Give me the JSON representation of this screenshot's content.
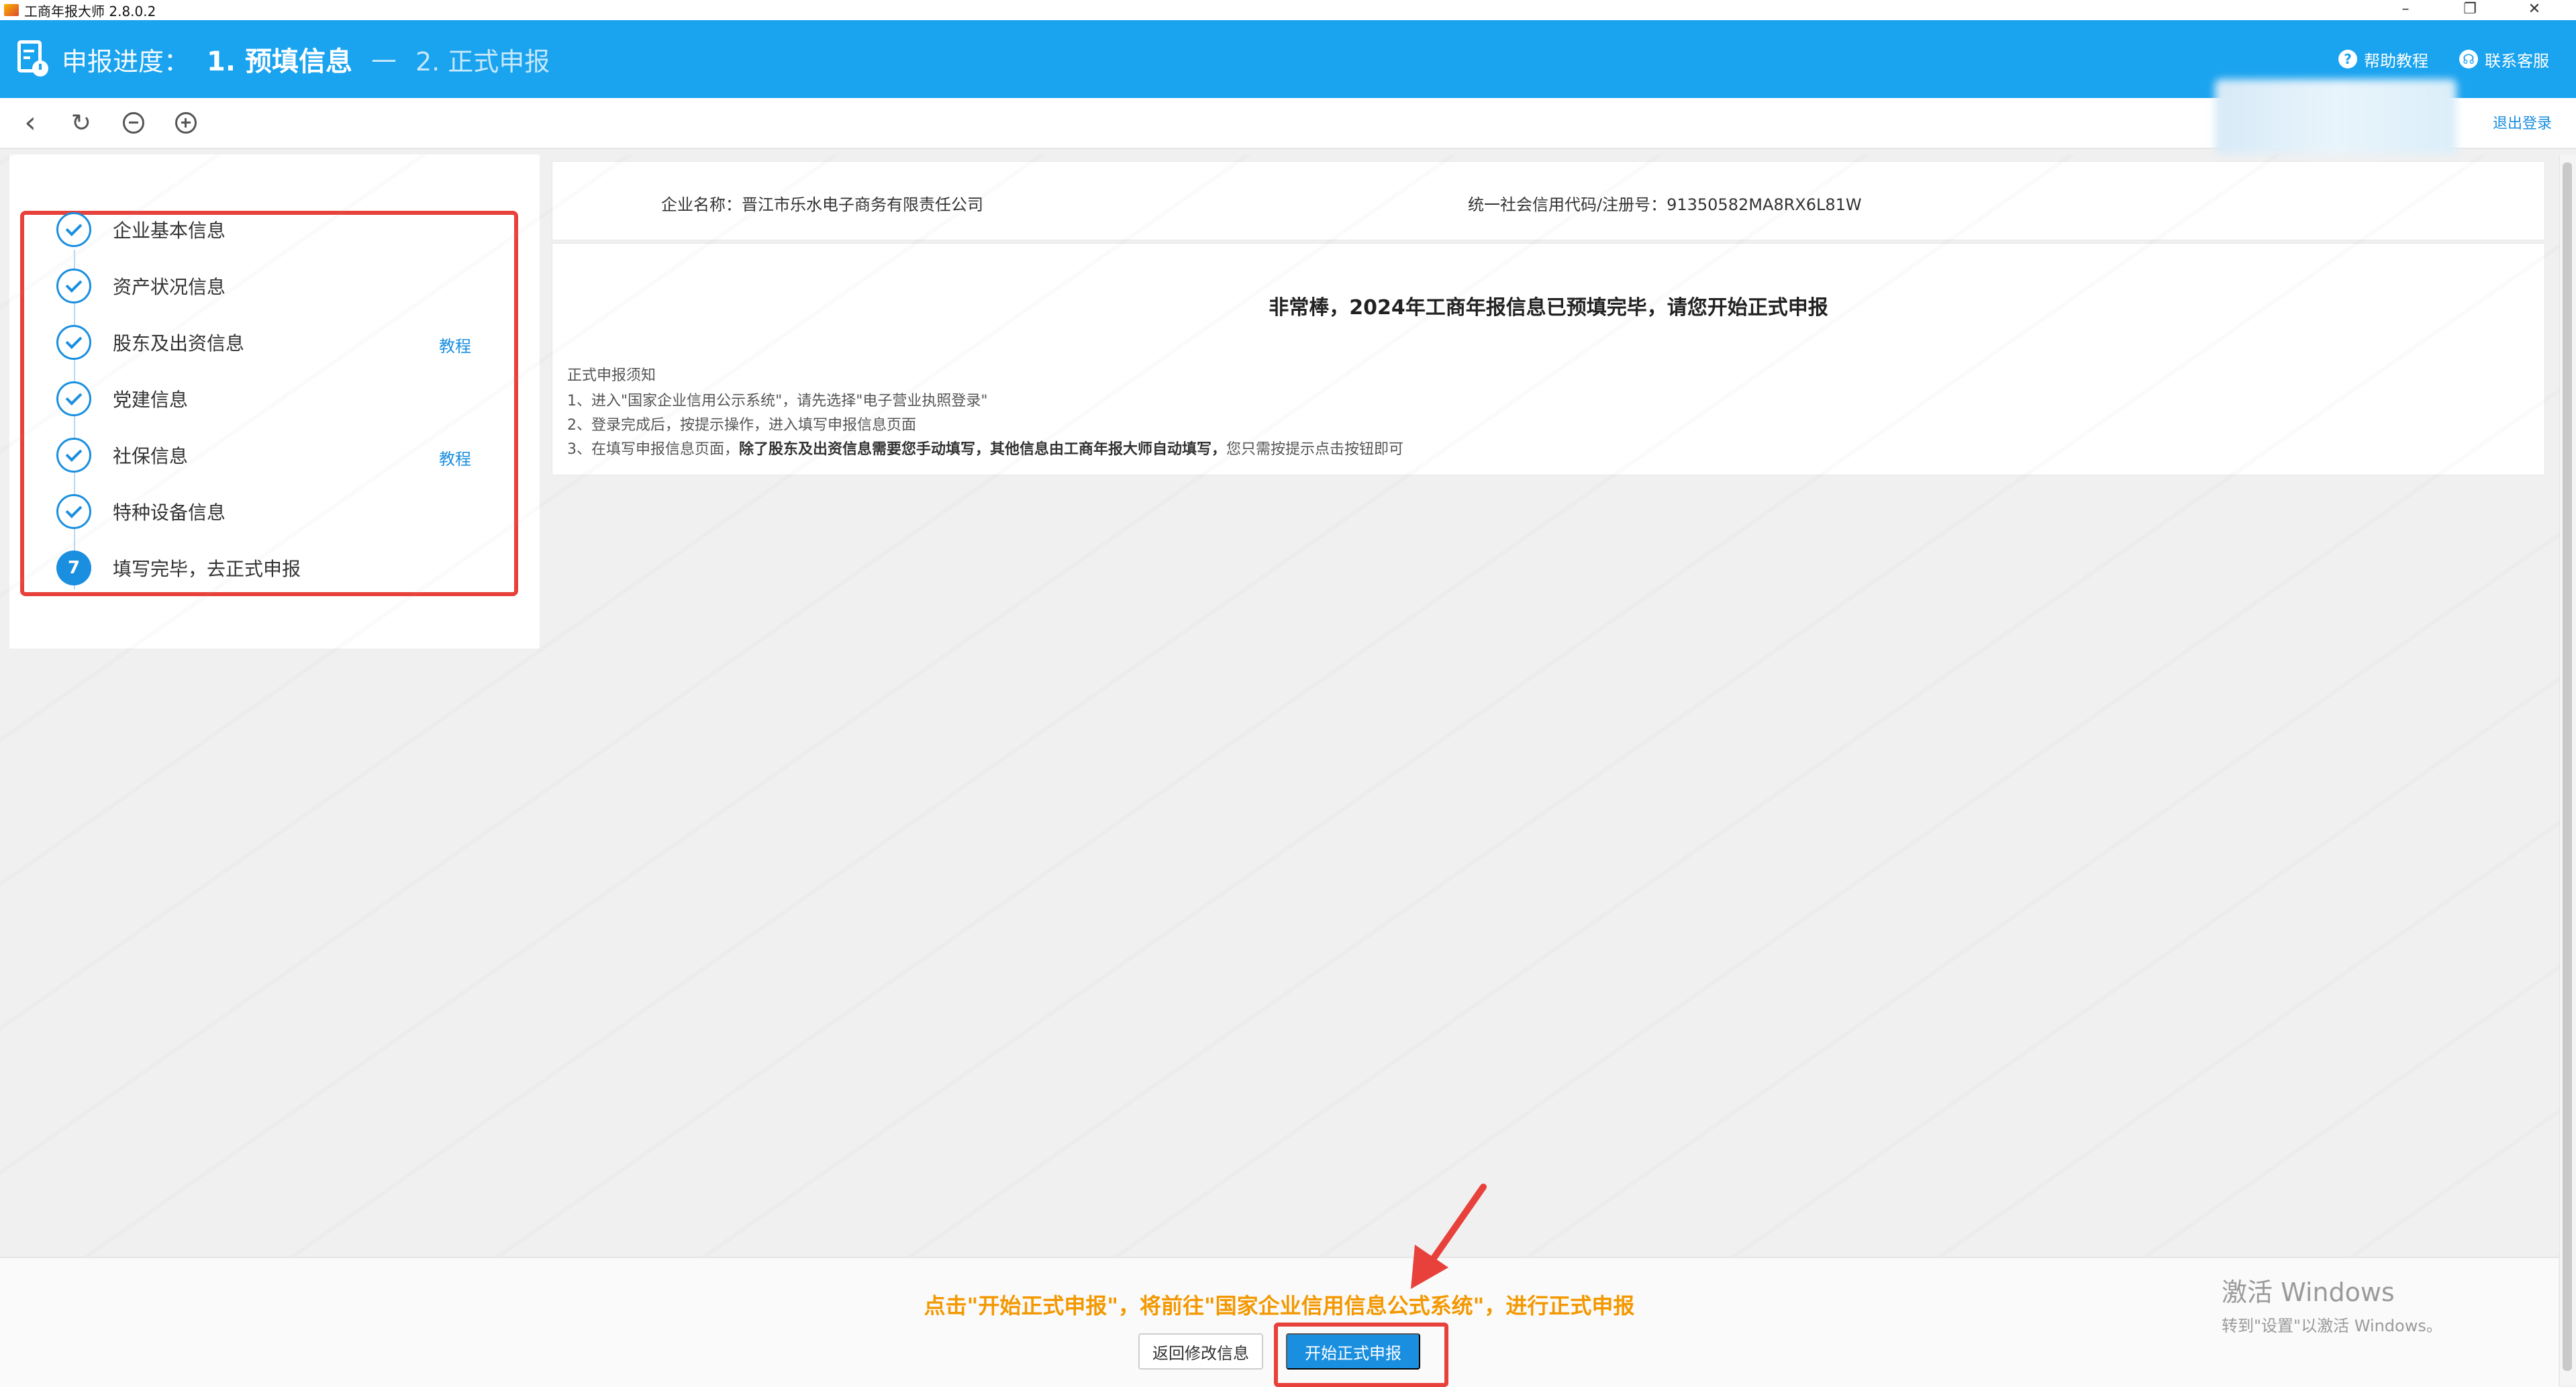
{
  "window": {
    "title": "工商年报大师 2.8.0.2",
    "controls": [
      "–",
      "❐",
      "✕"
    ]
  },
  "header": {
    "progress_label": "申报进度：",
    "step1": "1. 预填信息",
    "separator": "—",
    "step2": "2. 正式申报",
    "help_label": "帮助教程",
    "contact_label": "联系客服",
    "background_color": "#1aa3ef"
  },
  "toolbar": {
    "back_icon": "chevron-left-icon",
    "refresh_icon": "refresh-icon",
    "zoom_out_icon": "zoom-out-icon",
    "zoom_in_icon": "zoom-in-icon",
    "logout_label": "退出登录"
  },
  "sidebar": {
    "steps": [
      {
        "label": "企业基本信息",
        "status": "done",
        "link": ""
      },
      {
        "label": "资产状况信息",
        "status": "done",
        "link": ""
      },
      {
        "label": "股东及出资信息",
        "status": "done",
        "link": "教程"
      },
      {
        "label": "党建信息",
        "status": "done",
        "link": ""
      },
      {
        "label": "社保信息",
        "status": "done",
        "link": "教程"
      },
      {
        "label": "特种设备信息",
        "status": "done",
        "link": ""
      },
      {
        "label": "填写完毕，去正式申报",
        "status": "current",
        "number": "7",
        "link": ""
      }
    ]
  },
  "company": {
    "name": "企业名称：晋江市乐水电子商务有限责任公司",
    "credit_code": "统一社会信用代码/注册号：91350582MA8RX6L81W"
  },
  "notice": {
    "headline": "非常棒，2024年工商年报信息已预填完毕，请您开始正式申报",
    "title": "正式申报须知",
    "line1": "1、进入\"国家企业信用公示系统\"，请先选择\"电子营业执照登录\"",
    "line2": "2、登录完成后，按提示操作，进入填写申报信息页面",
    "line3_prefix": "3、在填写申报信息页面，",
    "line3_bold": "除了股东及出资信息需要您手动填写，其他信息由工商年报大师自动填写，",
    "line3_suffix": "您只需按提示点击按钮即可"
  },
  "bottom": {
    "note": "点击\"开始正式申报\"，将前往\"国家企业信用信息公式系统\"，进行正式申报",
    "back_button": "返回修改信息",
    "start_button": "开始正式申报",
    "note_color": "#f39800",
    "primary_color": "#1a8fe0",
    "highlight_color": "#e8403a"
  },
  "os_overlay": {
    "activate_title": "激活 Windows",
    "activate_sub": "转到\"设置\"以激活 Windows。"
  }
}
